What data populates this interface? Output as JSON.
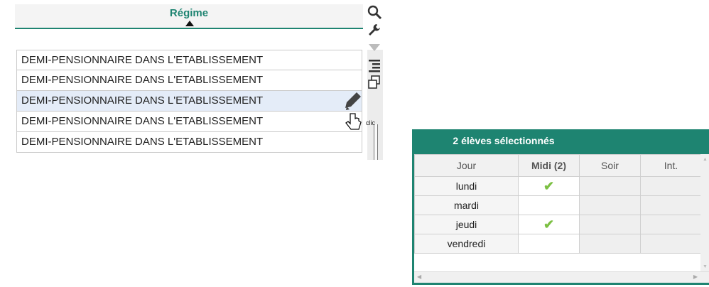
{
  "list": {
    "header": "Régime",
    "rows": [
      "DEMI-PENSIONNAIRE DANS L'ETABLISSEMENT",
      "DEMI-PENSIONNAIRE DANS L'ETABLISSEMENT",
      "DEMI-PENSIONNAIRE DANS L'ETABLISSEMENT",
      "DEMI-PENSIONNAIRE DANS L'ETABLISSEMENT",
      "DEMI-PENSIONNAIRE DANS L'ETABLISSEMENT"
    ],
    "selected_row": 2,
    "cursor_hint": "clic"
  },
  "grid": {
    "title": "2 élèves sélectionnés",
    "columns": [
      "Jour",
      "Midi (2)",
      "Soir",
      "Int."
    ],
    "rows": [
      {
        "day": "lundi",
        "midi": true
      },
      {
        "day": "mardi",
        "midi": false
      },
      {
        "day": "jeudi",
        "midi": true
      },
      {
        "day": "vendredi",
        "midi": false
      }
    ],
    "check_glyph": "✔"
  },
  "colors": {
    "accent": "#1e8471",
    "selected_row": "#e4ecf8",
    "check": "#7cc043"
  },
  "icons": [
    "search-icon",
    "wrench-icon",
    "sort-down-icon",
    "column-settings-icon",
    "copy-icon",
    "pencil-icon",
    "hand-cursor-icon"
  ]
}
